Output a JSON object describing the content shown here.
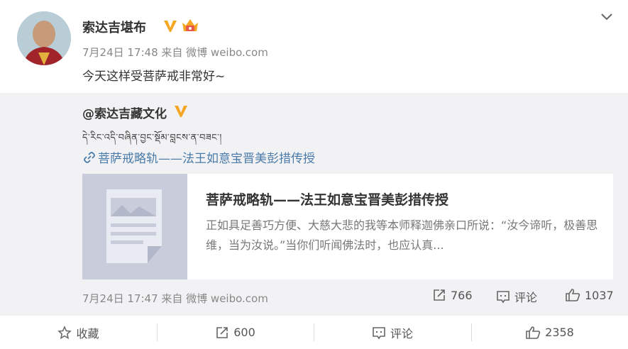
{
  "post": {
    "author": "索达吉堪布",
    "meta": "7月24日 17:48 来自 微博 weibo.com",
    "text": "今天这样受菩萨戒非常好~"
  },
  "repost": {
    "author": "@索达吉藏文化",
    "tibetan": "དེ་རིང་འདི་བཞིན་བྱང་སྡོམ་བླངས་ན་བཟང་།",
    "link_text": "菩萨戒略轨——法王如意宝晋美彭措传授",
    "card": {
      "title": "菩萨戒略轨——法王如意宝晋美彭措传授",
      "desc": "正如具足善巧方便、大慈大悲的我等本师释迦佛亲口所说：“汝今谛听，极善思维，当为汝说。”当你们听闻佛法时，也应认真..."
    },
    "meta": "7月24日 17:47 来自 微博 weibo.com",
    "repost_count": "766",
    "comment_label": "评论",
    "like_count": "1037"
  },
  "actions": {
    "favorite_label": "收藏",
    "repost_count": "600",
    "comment_label": "评论",
    "like_count": "2358"
  },
  "colors": {
    "link": "#4a7ba9",
    "verified": "#f5a623",
    "repost_bg": "#f2f2f5"
  }
}
